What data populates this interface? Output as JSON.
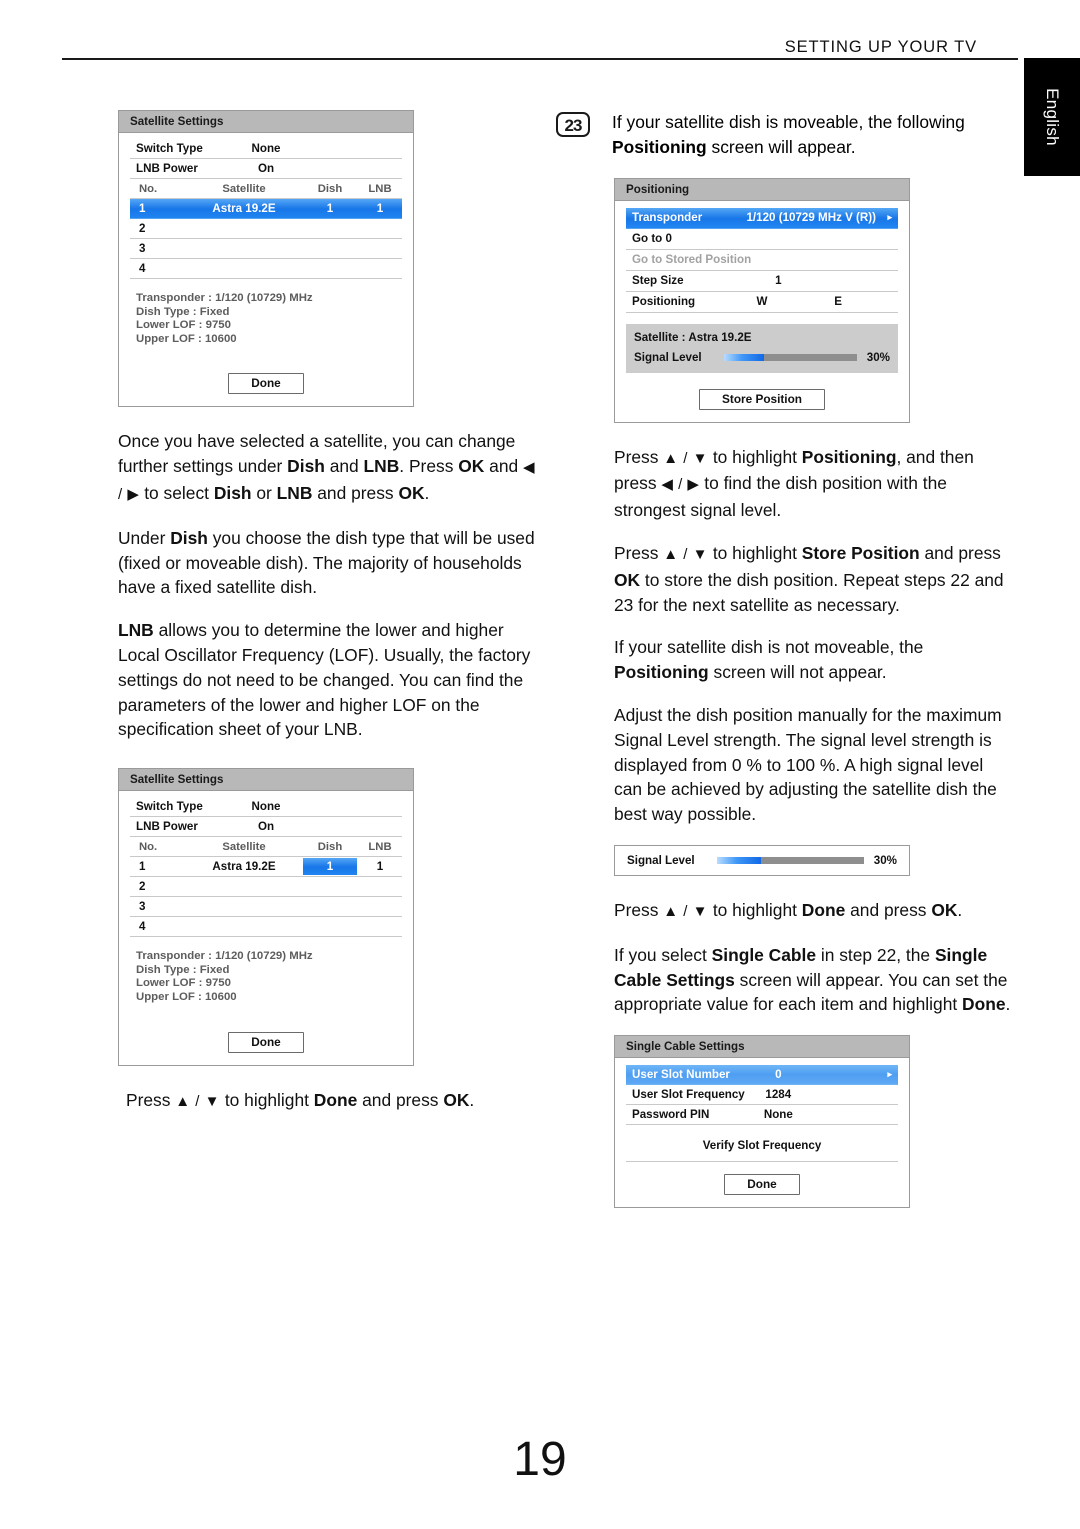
{
  "header": {
    "title": "SETTING UP YOUR TV",
    "language_tab": "English"
  },
  "page_number": "19",
  "left_column": {
    "satellite_settings_1": {
      "title": "Satellite Settings",
      "rows": [
        {
          "label": "Switch Type",
          "value": "None"
        },
        {
          "label": "LNB Power",
          "value": "On"
        }
      ],
      "table": {
        "headers": {
          "no": "No.",
          "satellite": "Satellite",
          "dish": "Dish",
          "lnb": "LNB"
        },
        "rows": [
          {
            "no": "1",
            "satellite": "Astra 19.2E",
            "dish": "1",
            "lnb": "1",
            "highlight": "row"
          },
          {
            "no": "2",
            "satellite": "",
            "dish": "",
            "lnb": "",
            "highlight": "none"
          },
          {
            "no": "3",
            "satellite": "",
            "dish": "",
            "lnb": "",
            "highlight": "none"
          },
          {
            "no": "4",
            "satellite": "",
            "dish": "",
            "lnb": "",
            "highlight": "none"
          }
        ]
      },
      "info": [
        "Transponder : 1/120 (10729) MHz",
        "Dish Type : Fixed",
        "Lower LOF : 9750",
        "Upper LOF : 10600"
      ],
      "button": "Done"
    },
    "paragraph_1": {
      "part1": "Once you have selected a satellite, you can change further settings under ",
      "b1": "Dish",
      "part2": " and ",
      "b2": "LNB",
      "part3": ". Press ",
      "b3": "OK",
      "part4": " and ",
      "arrows": "◀ / ▶",
      "part5": " to select ",
      "b4": "Dish",
      "part6": " or ",
      "b5": "LNB",
      "part7": " and press ",
      "b6": "OK",
      "part8": "."
    },
    "paragraph_2": {
      "part1": "Under ",
      "b1": "Dish",
      "part2": " you choose the dish type that will be used (fixed or moveable dish). The majority of households have a fixed satellite dish."
    },
    "paragraph_3": {
      "b1": "LNB",
      "part1": " allows you to determine the lower and higher Local Oscillator Frequency (LOF). Usually, the factory settings do not need to be changed. You can find the parameters of the lower and higher LOF on the specification sheet of your LNB."
    },
    "satellite_settings_2": {
      "title": "Satellite Settings",
      "rows": [
        {
          "label": "Switch Type",
          "value": "None"
        },
        {
          "label": "LNB Power",
          "value": "On"
        }
      ],
      "table": {
        "headers": {
          "no": "No.",
          "satellite": "Satellite",
          "dish": "Dish",
          "lnb": "LNB"
        },
        "rows": [
          {
            "no": "1",
            "satellite": "Astra 19.2E",
            "dish": "1",
            "lnb": "1",
            "highlight": "dish-cell"
          },
          {
            "no": "2",
            "satellite": "",
            "dish": "",
            "lnb": "",
            "highlight": "none"
          },
          {
            "no": "3",
            "satellite": "",
            "dish": "",
            "lnb": "",
            "highlight": "none"
          },
          {
            "no": "4",
            "satellite": "",
            "dish": "",
            "lnb": "",
            "highlight": "none"
          }
        ]
      },
      "info": [
        "Transponder : 1/120 (10729) MHz",
        "Dish Type : Fixed",
        "Lower LOF : 9750",
        "Upper LOF : 10600"
      ],
      "button": "Done"
    },
    "paragraph_4": {
      "part1": "Press ",
      "arrows": "▲ / ▼",
      "part2": " to highlight ",
      "b1": "Done",
      "part3": " and press ",
      "b2": "OK",
      "part4": "."
    }
  },
  "right_column": {
    "step": {
      "number": "23",
      "part1": "If your satellite dish is moveable, the following ",
      "b1": "Positioning",
      "part2": " screen will appear."
    },
    "positioning_screen": {
      "title": "Positioning",
      "rows": [
        {
          "label": "Transponder",
          "value": "1/120 (10729 MHz V (R))",
          "state": "selected",
          "arrow": "▸"
        },
        {
          "label": "Go to 0",
          "value": "",
          "state": "normal",
          "arrow": ""
        },
        {
          "label": "Go to Stored Position",
          "value": "",
          "state": "disabled",
          "arrow": ""
        },
        {
          "label": "Step Size",
          "value": "1",
          "state": "normal",
          "arrow": ""
        }
      ],
      "positioning_row": {
        "label": "Positioning",
        "west": "W",
        "east": "E"
      },
      "satellite_line": "Satellite : Astra 19.2E",
      "signal": {
        "label": "Signal Level",
        "percent_text": "30%",
        "percent": 30
      },
      "button": "Store Position"
    },
    "paragraph_1": {
      "part1": "Press ",
      "arrows1": "▲ / ▼",
      "part2": " to highlight ",
      "b1": "Positioning",
      "part3": ", and then press ",
      "arrows2": "◀ / ▶",
      "part4": " to find the dish position with the strongest signal level."
    },
    "paragraph_2": {
      "part1": "Press ",
      "arrows": "▲ / ▼",
      "part2": " to highlight ",
      "b1": "Store Position",
      "part3": " and press ",
      "b2": "OK",
      "part4": " to store the dish position. Repeat steps 22 and 23 for the next satellite as necessary."
    },
    "paragraph_3": {
      "part1": "If your satellite dish is not moveable, the ",
      "b1": "Positioning",
      "part2": " screen will not appear."
    },
    "paragraph_4": {
      "text": "Adjust the dish position manually for the maximum Signal Level strength. The signal level strength is displayed from 0 % to 100 %. A high signal level can be achieved by adjusting the satellite dish the best way possible."
    },
    "signal_box": {
      "label": "Signal Level",
      "percent_text": "30%",
      "percent": 30
    },
    "paragraph_5": {
      "part1": "Press ",
      "arrows": "▲ / ▼",
      "part2": " to highlight ",
      "b1": "Done",
      "part3": " and press ",
      "b2": "OK",
      "part4": "."
    },
    "paragraph_6": {
      "part1": "If you select ",
      "b1": "Single Cable",
      "part2": " in step 22, the ",
      "b2": "Single Cable Settings",
      "part3": " screen will appear. You can set the appropriate value for each item and highlight ",
      "b3": "Done",
      "part4": "."
    },
    "single_cable_settings": {
      "title": "Single Cable Settings",
      "rows": [
        {
          "label": "User Slot Number",
          "value": "0",
          "state": "selected",
          "arrow": "▸"
        },
        {
          "label": "User Slot Frequency",
          "value": "1284",
          "state": "normal",
          "arrow": ""
        },
        {
          "label": "Password PIN",
          "value": "None",
          "state": "normal",
          "arrow": ""
        }
      ],
      "verify": "Verify Slot Frequency",
      "button": "Done"
    }
  },
  "colors": {
    "highlight_blue": "#1876e8",
    "title_bar_gray": "#b8b8b8",
    "signal_panel_gray": "#cccccc",
    "disabled_text": "#a2a2a2"
  }
}
